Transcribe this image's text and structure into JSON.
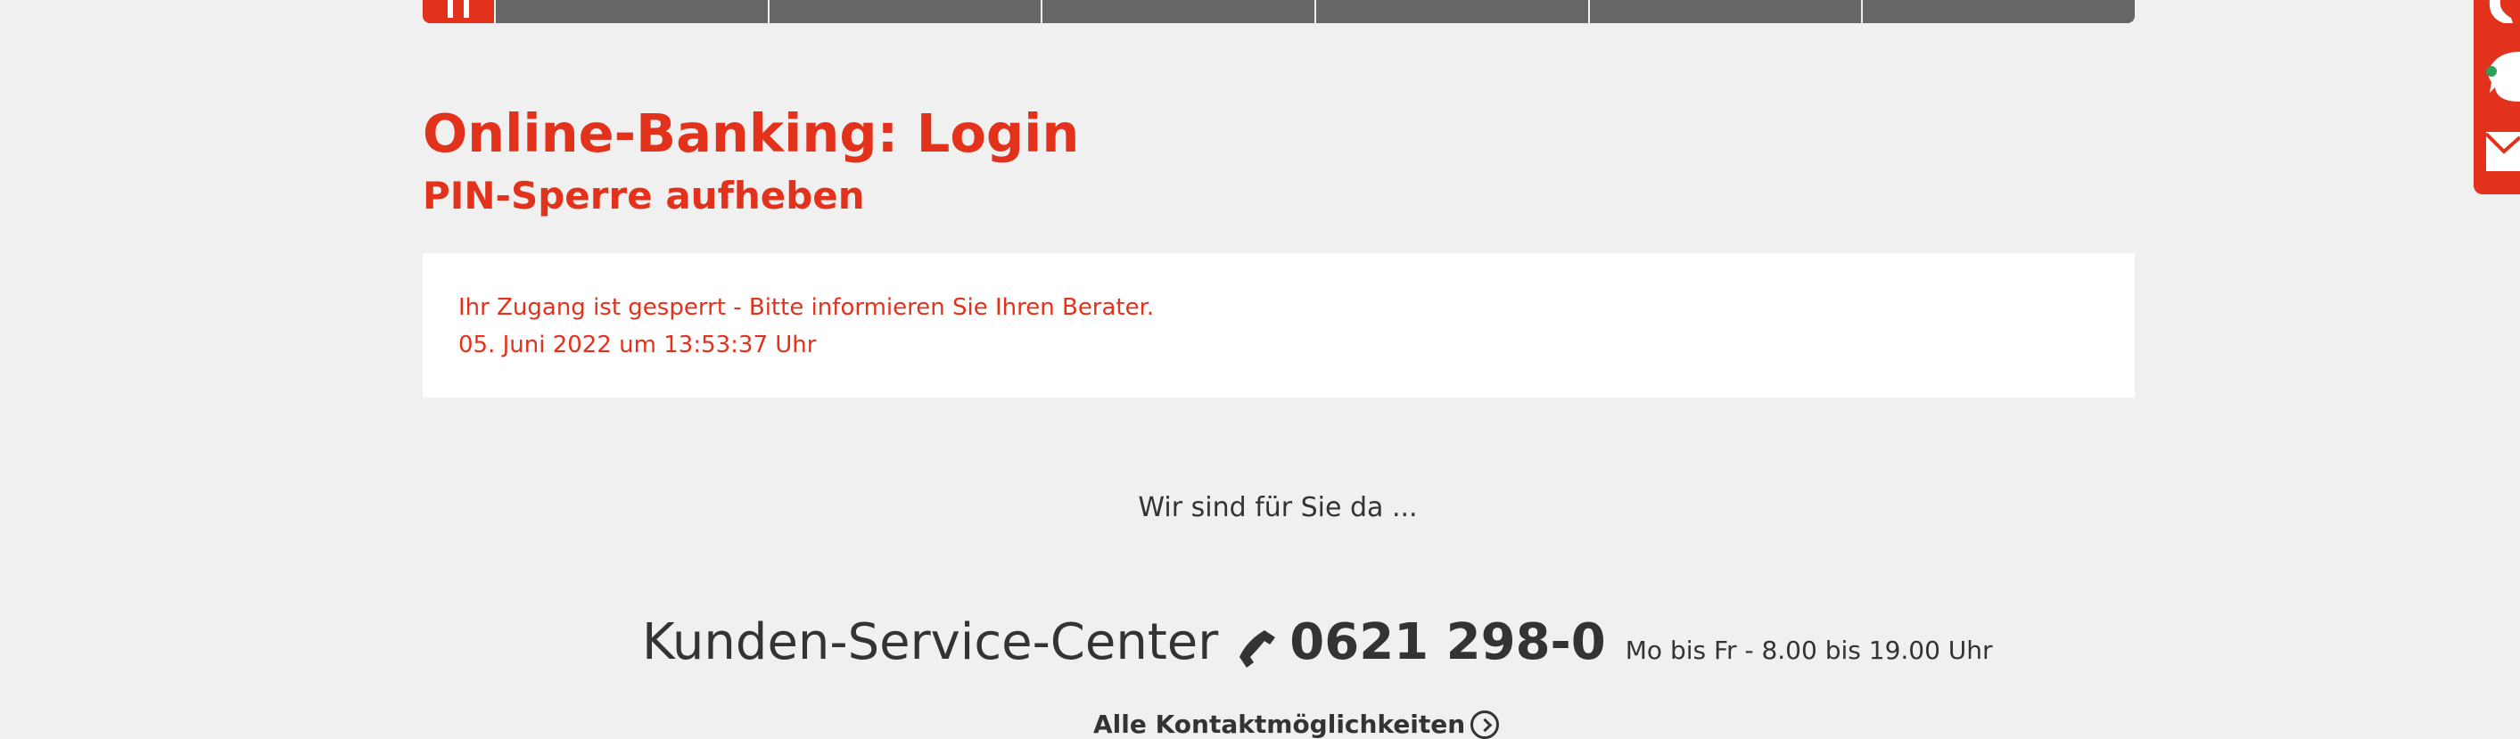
{
  "colors": {
    "brand": "#e3321c",
    "nav": "#666666",
    "background": "#f0f0f0",
    "text": "#333333"
  },
  "header": {
    "title": "Online-Banking: Login",
    "subtitle": "PIN-Sperre aufheben"
  },
  "alert": {
    "message": "Ihr Zugang ist gesperrt - Bitte informieren Sie Ihren Berater.",
    "timestamp": "05. Juni 2022 um 13:53:37 Uhr"
  },
  "service": {
    "intro": "Wir sind für Sie da ...",
    "name": "Kunden-Service-Center",
    "phone": "0621 298-0",
    "hours": "Mo bis Fr - 8.00 bis 19.00 Uhr",
    "contact_link": "Alle Kontaktmöglichkeiten"
  },
  "icons": [
    "home-icon",
    "phone-icon",
    "chat-icon",
    "mail-icon",
    "chevron-right-circle-icon"
  ]
}
